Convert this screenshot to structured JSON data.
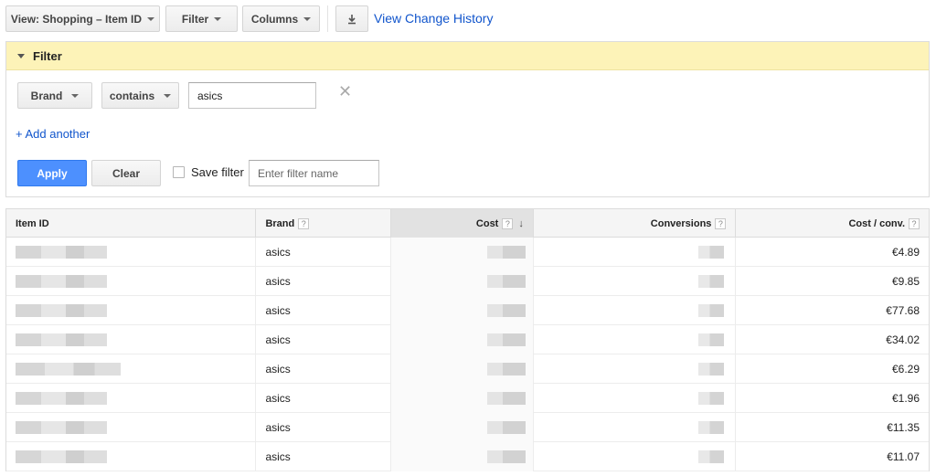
{
  "toolbar": {
    "view_label": "View: Shopping – Item ID",
    "filter_label": "Filter",
    "columns_label": "Columns",
    "download_icon": "download-icon",
    "view_change_history": "View Change History"
  },
  "filter": {
    "title": "Filter",
    "field_label": "Brand",
    "operator_label": "contains",
    "value": "asics",
    "add_another": "+ Add another",
    "apply_label": "Apply",
    "clear_label": "Clear",
    "save_filter_label": "Save filter",
    "filter_name_placeholder": "Enter filter name"
  },
  "table": {
    "columns": [
      "Item ID",
      "Brand",
      "Cost",
      "Conversions",
      "Cost / conv."
    ],
    "help_icon": "?",
    "sort_icon": "↓",
    "rows": [
      {
        "brand": "asics",
        "cost_per_conv": "€4.89"
      },
      {
        "brand": "asics",
        "cost_per_conv": "€9.85"
      },
      {
        "brand": "asics",
        "cost_per_conv": "€77.68"
      },
      {
        "brand": "asics",
        "cost_per_conv": "€34.02"
      },
      {
        "brand": "asics",
        "cost_per_conv": "€6.29"
      },
      {
        "brand": "asics",
        "cost_per_conv": "€1.96"
      },
      {
        "brand": "asics",
        "cost_per_conv": "€11.35"
      },
      {
        "brand": "asics",
        "cost_per_conv": "€11.07"
      }
    ]
  },
  "colors": {
    "accent_blue": "#4d90fe",
    "link_blue": "#1155cc",
    "filter_header_bg": "#fdf3b8"
  }
}
